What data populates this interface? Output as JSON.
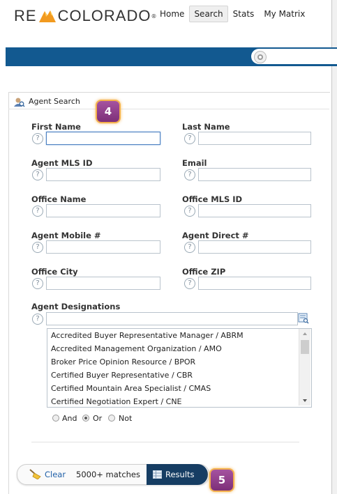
{
  "header": {
    "logo_left": "RE",
    "logo_right": "COLORADO",
    "logo_reg": "®",
    "nav": [
      {
        "label": "Home",
        "active": false
      },
      {
        "label": "Search",
        "active": true
      },
      {
        "label": "Stats",
        "active": false
      },
      {
        "label": "My Matrix",
        "active": false
      }
    ]
  },
  "colors": {
    "brand_bar": "#125990",
    "badge": "#9b4797",
    "results_button": "#163d63"
  },
  "panel": {
    "title": "Agent Search",
    "fields": [
      {
        "label": "First Name",
        "value": "",
        "focused": true
      },
      {
        "label": "Last Name",
        "value": ""
      },
      {
        "label": "Agent MLS ID",
        "value": ""
      },
      {
        "label": "Email",
        "value": ""
      },
      {
        "label": "Office Name",
        "value": ""
      },
      {
        "label": "Office MLS ID",
        "value": ""
      },
      {
        "label": "Agent Mobile #",
        "value": ""
      },
      {
        "label": "Agent Direct #",
        "value": ""
      },
      {
        "label": "Office City",
        "value": ""
      },
      {
        "label": "Office ZIP",
        "value": ""
      }
    ],
    "help_glyph": "?",
    "designations": {
      "label": "Agent Designations",
      "value": "",
      "options": [
        "Accredited Buyer Representative Manager / ABRM",
        "Accredited Management Organization / AMO",
        "Broker Price Opinion Resource / BPOR",
        "Certified Buyer Representative / CBR",
        "Certified Mountain Area Specialist / CMAS",
        "Certified Negotiation Expert / CNE"
      ],
      "match_options": [
        {
          "label": "And",
          "selected": false
        },
        {
          "label": "Or",
          "selected": true
        },
        {
          "label": "Not",
          "selected": false
        }
      ]
    }
  },
  "footer": {
    "clear_label": "Clear",
    "matches_label": "5000+ matches",
    "results_label": "Results"
  },
  "callouts": {
    "step_4": "4",
    "step_5": "5"
  }
}
